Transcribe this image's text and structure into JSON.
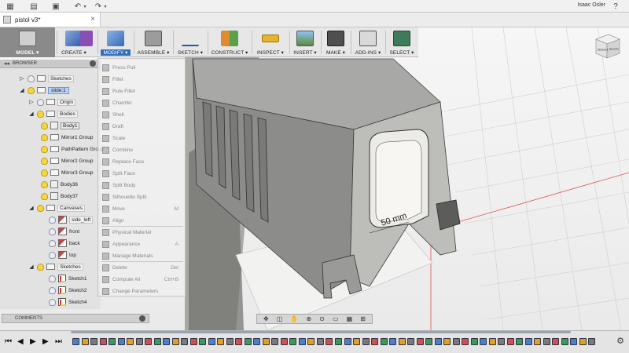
{
  "app": {
    "document_title": "pistol v3*",
    "user_name": "Isaac Osler",
    "help_glyph": "?"
  },
  "toolbar": {
    "workspace": "MODEL",
    "groups": [
      {
        "key": "create",
        "label": "CREATE",
        "icon": "create-box-icon"
      },
      {
        "key": "modify",
        "label": "MODIFY",
        "icon": "modify-press-pull-icon",
        "active": true
      },
      {
        "key": "assemble",
        "label": "ASSEMBLE",
        "icon": "assemble-joint-icon"
      },
      {
        "key": "sketch",
        "label": "SKETCH",
        "icon": "sketch-line-icon"
      },
      {
        "key": "construct",
        "label": "CONSTRUCT",
        "icon": "construct-plane-icon"
      },
      {
        "key": "inspect",
        "label": "INSPECT",
        "icon": "inspect-measure-icon"
      },
      {
        "key": "insert",
        "label": "INSERT",
        "icon": "insert-image-icon"
      },
      {
        "key": "make",
        "label": "MAKE",
        "icon": "make-3d-print-icon"
      },
      {
        "key": "addins",
        "label": "ADD-INS",
        "icon": "addins-script-icon"
      },
      {
        "key": "select",
        "label": "SELECT",
        "icon": "select-cursor-icon"
      }
    ]
  },
  "modify_menu": {
    "items": [
      {
        "label": "Press Pull",
        "shortcut": ""
      },
      {
        "label": "Fillet",
        "shortcut": ""
      },
      {
        "label": "Rule Fillet",
        "shortcut": ""
      },
      {
        "label": "Chamfer",
        "shortcut": ""
      },
      {
        "label": "Shell",
        "shortcut": ""
      },
      {
        "label": "Draft",
        "shortcut": ""
      },
      {
        "label": "Scale",
        "shortcut": ""
      },
      {
        "label": "Combine",
        "shortcut": ""
      },
      {
        "label": "Replace Face",
        "shortcut": ""
      },
      {
        "label": "Split Face",
        "shortcut": ""
      },
      {
        "label": "Split Body",
        "shortcut": ""
      },
      {
        "label": "Silhouette Split",
        "shortcut": ""
      },
      {
        "label": "Move",
        "shortcut": "M"
      },
      {
        "label": "Align",
        "shortcut": ""
      },
      {
        "label": "Physical Material",
        "shortcut": ""
      },
      {
        "label": "Appearance",
        "shortcut": "A"
      },
      {
        "label": "Manage Materials",
        "shortcut": ""
      },
      {
        "label": "Delete",
        "shortcut": "Del"
      },
      {
        "label": "Compute All",
        "shortcut": "Ctrl+B"
      },
      {
        "label": "Change Parameters",
        "shortcut": ""
      }
    ]
  },
  "browser": {
    "title": "BROWSER",
    "rows": [
      {
        "label": "Sketches",
        "icon": "folder"
      },
      {
        "label": "slide:1",
        "icon": "component"
      },
      {
        "label": "Origin",
        "icon": "folder"
      },
      {
        "label": "Bodies",
        "icon": "folder"
      },
      {
        "label": "Body1",
        "icon": "body"
      },
      {
        "label": "Mirror1 Group",
        "icon": "folder"
      },
      {
        "label": "PathPattern Group",
        "icon": "folder"
      },
      {
        "label": "Mirror2 Group",
        "icon": "folder"
      },
      {
        "label": "Mirror3 Group",
        "icon": "folder"
      },
      {
        "label": "Body36",
        "icon": "body"
      },
      {
        "label": "Body37",
        "icon": "body"
      },
      {
        "label": "Canvases",
        "icon": "folder"
      },
      {
        "label": "side_left",
        "icon": "canvas"
      },
      {
        "label": "front",
        "icon": "canvas"
      },
      {
        "label": "back",
        "icon": "canvas"
      },
      {
        "label": "top",
        "icon": "canvas"
      },
      {
        "label": "Sketches",
        "icon": "folder"
      },
      {
        "label": "Sketch1",
        "icon": "sketch"
      },
      {
        "label": "Sketch2",
        "icon": "sketch"
      },
      {
        "label": "Sketch4",
        "icon": "sketch"
      }
    ]
  },
  "comments": {
    "title": "COMMENTS"
  },
  "viewport": {
    "dimension_label": "50 mm",
    "view_cube_face": "BACK",
    "view_cube_side": "RIGHT"
  },
  "timeline": {
    "controls": [
      "skip-to-start",
      "step-back",
      "play",
      "step-forward",
      "skip-to-end"
    ],
    "feature_count": 58
  }
}
